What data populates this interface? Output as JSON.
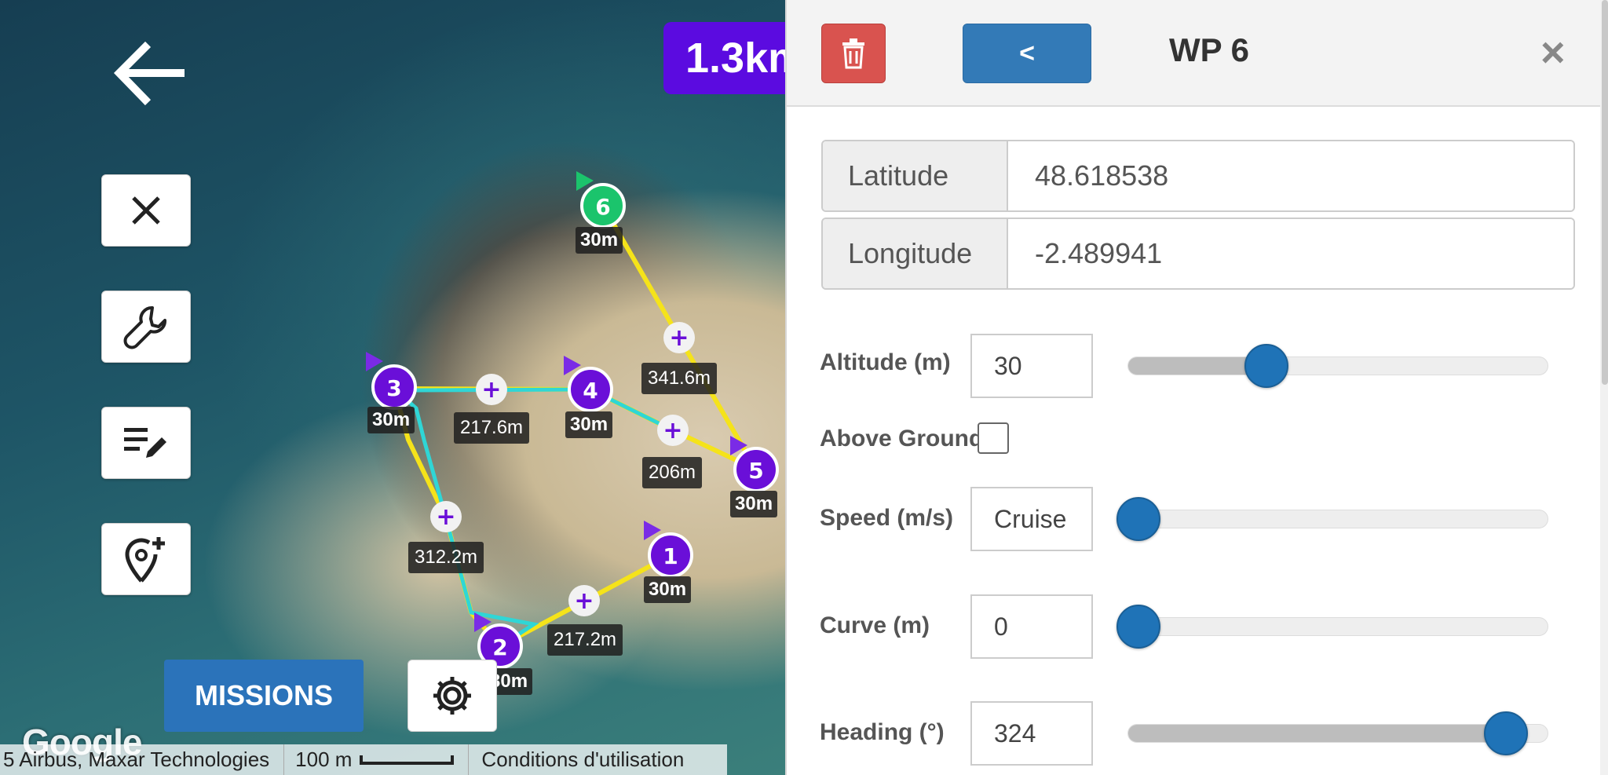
{
  "map": {
    "total_distance": "1.3km",
    "missions_label": "MISSIONS",
    "google_logo": "Google",
    "attribution": "5 Airbus, Maxar Technologies",
    "scale": "100 m",
    "terms": "Conditions d'utilisation",
    "waypoints": [
      {
        "label": "1",
        "altitude": "30m"
      },
      {
        "label": "2",
        "altitude": "30m"
      },
      {
        "label": "3",
        "altitude": "30m"
      },
      {
        "label": "4",
        "altitude": "30m"
      },
      {
        "label": "5",
        "altitude": "30m"
      },
      {
        "label": "6",
        "altitude": "30m"
      }
    ],
    "segments": [
      "217.2m",
      "312.2m",
      "217.6m",
      "206m",
      "341.6m"
    ],
    "colors": {
      "waypoint": "#6a0fd8",
      "selected_waypoint": "#1bc46c",
      "path": "#f5e31a",
      "path_alt": "#2fd6d6"
    }
  },
  "panel": {
    "title": "WP 6",
    "prev_label": "<",
    "close_label": "×",
    "latitude_label": "Latitude",
    "latitude_value": "48.618538",
    "longitude_label": "Longitude",
    "longitude_value": "-2.489941",
    "altitude_label": "Altitude (m)",
    "altitude_value": "30",
    "altitude_level": 0.33,
    "above_ground_label": "Above Ground",
    "above_ground_checked": false,
    "speed_label": "Speed (m/s)",
    "speed_value": "Cruise",
    "speed_level": 0.0,
    "curve_label": "Curve (m)",
    "curve_value": "0",
    "curve_level": 0.0,
    "heading_label": "Heading (°)",
    "heading_value": "324",
    "heading_level": 0.9,
    "accent": "#1f73b7",
    "delete_color": "#d9534f"
  }
}
